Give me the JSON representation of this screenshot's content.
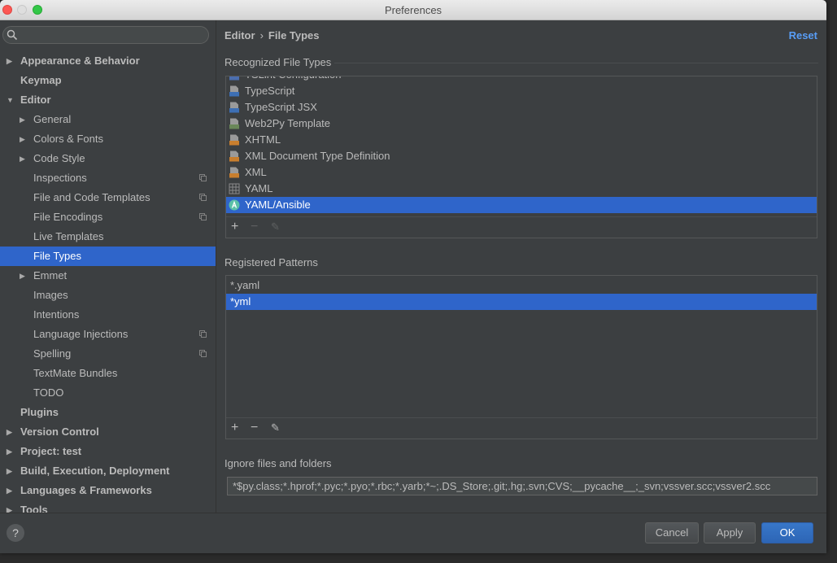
{
  "window": {
    "title": "Preferences"
  },
  "search": {
    "placeholder": ""
  },
  "sidebar": {
    "items": [
      {
        "label": "Appearance & Behavior",
        "level": 0,
        "bold": true,
        "arrow": "collapsed"
      },
      {
        "label": "Keymap",
        "level": 0,
        "bold": true,
        "arrow": "none"
      },
      {
        "label": "Editor",
        "level": 0,
        "bold": true,
        "arrow": "expanded"
      },
      {
        "label": "General",
        "level": 1,
        "bold": false,
        "arrow": "collapsed"
      },
      {
        "label": "Colors & Fonts",
        "level": 1,
        "bold": false,
        "arrow": "collapsed"
      },
      {
        "label": "Code Style",
        "level": 1,
        "bold": false,
        "arrow": "collapsed"
      },
      {
        "label": "Inspections",
        "level": 1,
        "bold": false,
        "arrow": "none",
        "copy": true
      },
      {
        "label": "File and Code Templates",
        "level": 1,
        "bold": false,
        "arrow": "none",
        "copy": true
      },
      {
        "label": "File Encodings",
        "level": 1,
        "bold": false,
        "arrow": "none",
        "copy": true
      },
      {
        "label": "Live Templates",
        "level": 1,
        "bold": false,
        "arrow": "none"
      },
      {
        "label": "File Types",
        "level": 1,
        "bold": false,
        "arrow": "none",
        "selected": true
      },
      {
        "label": "Emmet",
        "level": 1,
        "bold": false,
        "arrow": "collapsed"
      },
      {
        "label": "Images",
        "level": 1,
        "bold": false,
        "arrow": "none"
      },
      {
        "label": "Intentions",
        "level": 1,
        "bold": false,
        "arrow": "none"
      },
      {
        "label": "Language Injections",
        "level": 1,
        "bold": false,
        "arrow": "none",
        "copy": true
      },
      {
        "label": "Spelling",
        "level": 1,
        "bold": false,
        "arrow": "none",
        "copy": true
      },
      {
        "label": "TextMate Bundles",
        "level": 1,
        "bold": false,
        "arrow": "none"
      },
      {
        "label": "TODO",
        "level": 1,
        "bold": false,
        "arrow": "none"
      },
      {
        "label": "Plugins",
        "level": 0,
        "bold": true,
        "arrow": "none"
      },
      {
        "label": "Version Control",
        "level": 0,
        "bold": true,
        "arrow": "collapsed"
      },
      {
        "label": "Project: test",
        "level": 0,
        "bold": true,
        "arrow": "collapsed"
      },
      {
        "label": "Build, Execution, Deployment",
        "level": 0,
        "bold": true,
        "arrow": "collapsed"
      },
      {
        "label": "Languages & Frameworks",
        "level": 0,
        "bold": true,
        "arrow": "collapsed"
      },
      {
        "label": "Tools",
        "level": 0,
        "bold": true,
        "arrow": "collapsed"
      }
    ]
  },
  "header": {
    "crumb_parent": "Editor",
    "crumb_separator": "›",
    "crumb_current": "File Types",
    "reset": "Reset"
  },
  "recognized": {
    "title": "Recognized File Types",
    "items": [
      {
        "label": "TSLint Configuration",
        "icon": "json-file-icon"
      },
      {
        "label": "TypeScript",
        "icon": "typescript-file-icon"
      },
      {
        "label": "TypeScript JSX",
        "icon": "tsx-file-icon"
      },
      {
        "label": "Web2Py Template",
        "icon": "web2py-file-icon"
      },
      {
        "label": "XHTML",
        "icon": "xhtml-file-icon"
      },
      {
        "label": "XML Document Type Definition",
        "icon": "dtd-file-icon"
      },
      {
        "label": "XML",
        "icon": "xml-file-icon"
      },
      {
        "label": "YAML",
        "icon": "yaml-file-icon"
      },
      {
        "label": "YAML/Ansible",
        "icon": "ansible-file-icon",
        "selected": true
      }
    ],
    "toolbar": {
      "add": "+",
      "remove": "−",
      "edit": "✎"
    }
  },
  "patterns": {
    "title": "Registered Patterns",
    "items": [
      {
        "label": "*.yaml"
      },
      {
        "label": "*yml",
        "selected": true
      }
    ],
    "toolbar": {
      "add": "+",
      "remove": "−",
      "edit": "✎"
    }
  },
  "ignore": {
    "label": "Ignore files and folders",
    "value": "*$py.class;*.hprof;*.pyc;*.pyo;*.rbc;*.yarb;*~;.DS_Store;.git;.hg;.svn;CVS;__pycache__;_svn;vssver.scc;vssver2.scc"
  },
  "buttons": {
    "help": "?",
    "cancel": "Cancel",
    "apply": "Apply",
    "ok": "OK"
  },
  "colors": {
    "selection": "#2f65ca",
    "link": "#589df6",
    "panel": "#3c3f41"
  }
}
